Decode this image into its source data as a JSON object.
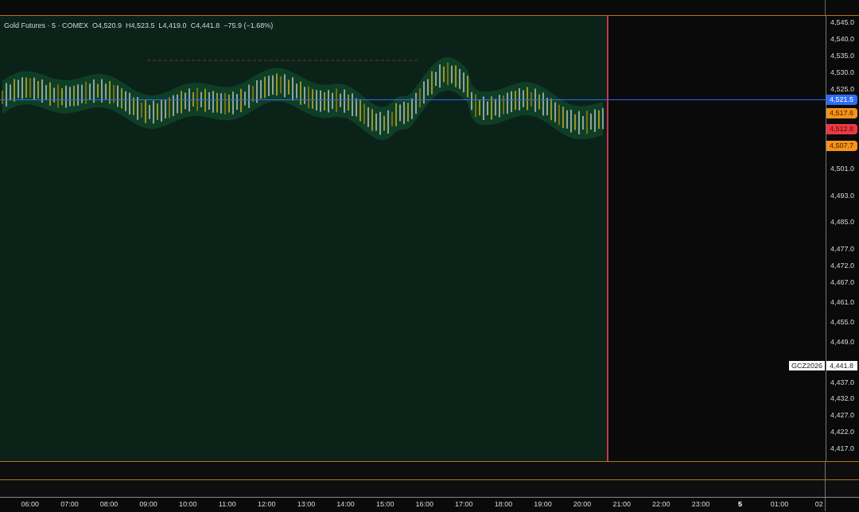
{
  "legend": {
    "symbol": "Gold Futures · 5 · COMEX",
    "open": "O4,520.9",
    "high": "H4,523.5",
    "low": "L4,419.0",
    "close": "C4,441.8",
    "change": "−75.9 (−1.68%)"
  },
  "price_axis": {
    "labels": [
      "4,545.0",
      "4,540.0",
      "4,535.0",
      "4,530.0",
      "4,525.0",
      "4,501.0",
      "4,493.0",
      "4,485.0",
      "4,477.0",
      "4,472.0",
      "4,467.0",
      "4,461.0",
      "4,455.0",
      "4,449.0",
      "4,437.0",
      "4,432.0",
      "4,427.0",
      "4,422.0",
      "4,417.0"
    ],
    "tags": [
      {
        "value": "4,521.5",
        "color": "#2e6cf6"
      },
      {
        "value": "4,517.6",
        "color": "#f7931a"
      },
      {
        "value": "4,512.8",
        "color": "#f23645"
      },
      {
        "value": "4,507.7",
        "color": "#f7931a"
      }
    ],
    "symbol_tag": {
      "name": "GCZ2026",
      "value": "4,441.8"
    }
  },
  "time_axis": {
    "labels": [
      {
        "text": "06:00",
        "bold": false
      },
      {
        "text": "07:00",
        "bold": false
      },
      {
        "text": "08:00",
        "bold": false
      },
      {
        "text": "09:00",
        "bold": false
      },
      {
        "text": "10:00",
        "bold": false
      },
      {
        "text": "11:00",
        "bold": false
      },
      {
        "text": "12:00",
        "bold": false
      },
      {
        "text": "13:00",
        "bold": false
      },
      {
        "text": "14:00",
        "bold": false
      },
      {
        "text": "15:00",
        "bold": false
      },
      {
        "text": "16:00",
        "bold": false
      },
      {
        "text": "17:00",
        "bold": false
      },
      {
        "text": "18:00",
        "bold": false
      },
      {
        "text": "19:00",
        "bold": false
      },
      {
        "text": "20:00",
        "bold": false
      },
      {
        "text": "21:00",
        "bold": false
      },
      {
        "text": "22:00",
        "bold": false
      },
      {
        "text": "23:00",
        "bold": false
      },
      {
        "text": "5",
        "bold": true
      },
      {
        "text": "01:00",
        "bold": false
      },
      {
        "text": "02",
        "bold": false
      }
    ]
  }
}
